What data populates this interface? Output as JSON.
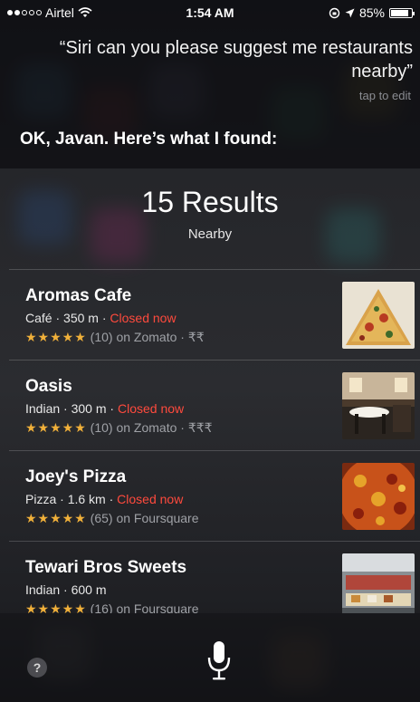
{
  "status_bar": {
    "carrier": "Airtel",
    "time": "1:54 AM",
    "battery": "85%",
    "battery_level": 0.85
  },
  "siri": {
    "query": "“Siri can you please suggest me restaurants nearby”",
    "tap_to_edit": "tap to edit",
    "reply": "OK, Javan. Here’s what I found:"
  },
  "results": {
    "title": "15 Results",
    "subtitle": "Nearby",
    "items": [
      {
        "name": "Aromas Cafe",
        "category": "Café",
        "distance": "350 m",
        "status": "Closed now",
        "stars": "★★★★★",
        "review_count": "(10)",
        "source": "on Zomato",
        "price": "₹₹",
        "thumb_icon": "pizza-slice-photo"
      },
      {
        "name": "Oasis",
        "category": "Indian",
        "distance": "300 m",
        "status": "Closed now",
        "stars": "★★★★★",
        "review_count": "(10)",
        "source": "on Zomato",
        "price": "₹₹₹",
        "thumb_icon": "dining-room-photo"
      },
      {
        "name": "Joey's Pizza",
        "category": "Pizza",
        "distance": "1.6 km",
        "status": "Closed now",
        "stars": "★★★★★",
        "review_count": "(65)",
        "source": "on Foursquare",
        "price": "",
        "thumb_icon": "pizza-photo"
      },
      {
        "name": "Tewari Bros Sweets",
        "category": "Indian",
        "distance": "600 m",
        "status": "",
        "stars": "★★★★★",
        "review_count": "(16)",
        "source": "on Foursquare",
        "price": "",
        "thumb_icon": "sweet-shop-photo"
      }
    ]
  },
  "controls": {
    "help_label": "?",
    "mic_icon": "microphone-icon"
  },
  "colors": {
    "closed": "#ff4a3d",
    "stars": "#f0b03a",
    "secondary_text": "#9fa1a6"
  }
}
